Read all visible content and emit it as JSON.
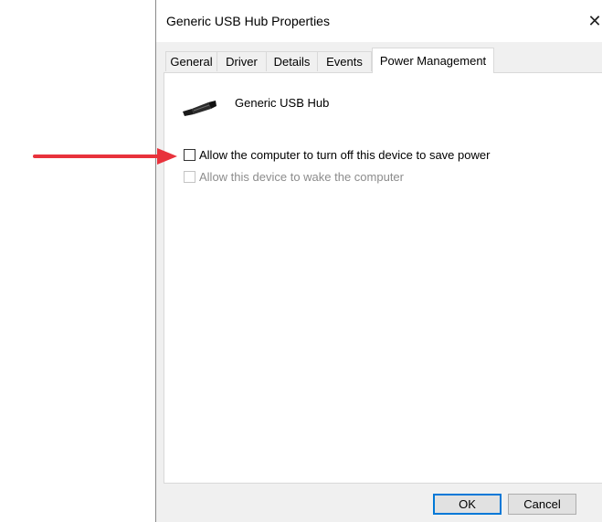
{
  "window": {
    "title": "Generic USB Hub Properties",
    "close_glyph": "✕"
  },
  "tabs": [
    {
      "label": "General"
    },
    {
      "label": "Driver"
    },
    {
      "label": "Details"
    },
    {
      "label": "Events"
    },
    {
      "label": "Power Management",
      "active": true
    }
  ],
  "device": {
    "icon": "usb-plug-icon",
    "name": "Generic USB Hub"
  },
  "options": [
    {
      "label": "Allow the computer to turn off this device to save power",
      "checked": false,
      "enabled": true
    },
    {
      "label": "Allow this device to wake the computer",
      "checked": false,
      "enabled": false
    }
  ],
  "buttons": {
    "ok_label": "OK",
    "cancel_label": "Cancel"
  },
  "annotation": {
    "arrow_color": "#e8323c"
  }
}
